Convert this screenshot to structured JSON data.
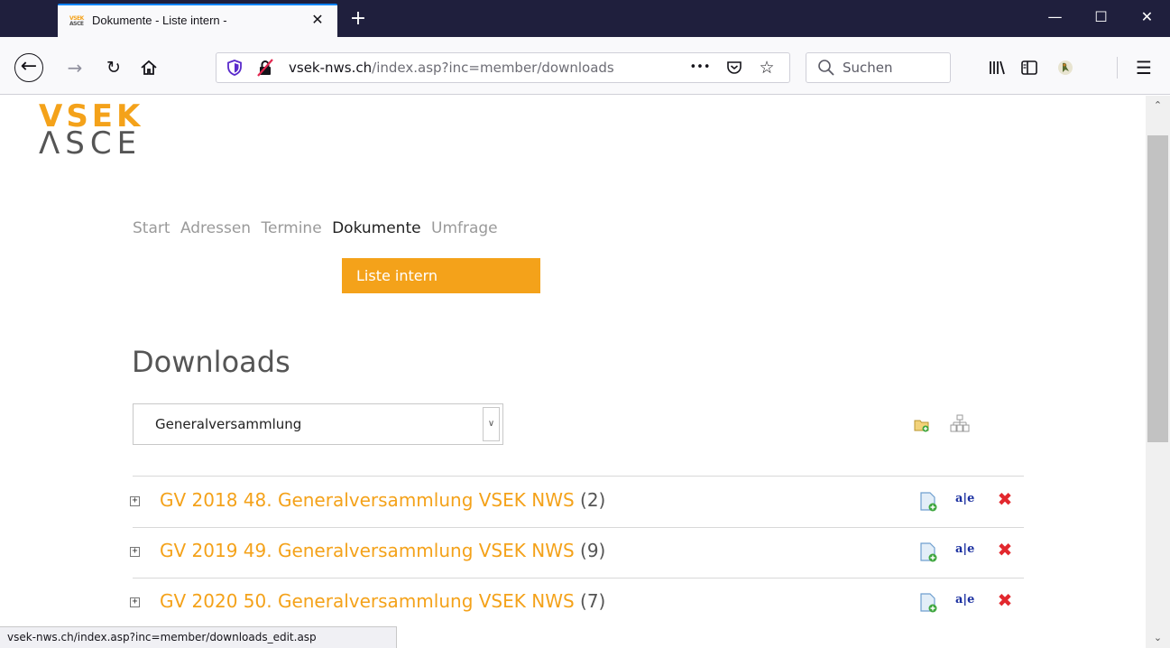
{
  "browser": {
    "tab_title": "Dokumente - Liste intern -",
    "favicon_text_top": "VSEK",
    "favicon_text_bottom": "ASCE",
    "new_tab": "+",
    "tab_close": "✕",
    "url_domain": "vsek-nws.ch",
    "url_path": "/index.asp?inc=member/downloads",
    "search_placeholder": "Suchen",
    "page_actions": "•••",
    "status_url": "vsek-nws.ch/index.asp?inc=member/downloads_edit.asp",
    "accent_color": "#0a84ff"
  },
  "site": {
    "logo_line1": "VSEK",
    "logo_line2": "ΛSCE",
    "brand_color": "#f4a21a"
  },
  "nav": {
    "items": [
      {
        "label": "Start"
      },
      {
        "label": "Adressen"
      },
      {
        "label": "Termine"
      },
      {
        "label": "Dokumente"
      },
      {
        "label": "Umfrage"
      }
    ],
    "active": "Dokumente",
    "subnav_label": "Liste intern"
  },
  "main": {
    "heading": "Downloads",
    "category_select": {
      "value": "Generalversammlung"
    },
    "rows": [
      {
        "title": "GV 2018 48. Generalversammlung VSEK NWS",
        "count": "(2)"
      },
      {
        "title": "GV 2019 49. Generalversammlung VSEK NWS",
        "count": "(9)"
      },
      {
        "title": "GV 2020 50. Generalversammlung VSEK NWS",
        "count": "(7)"
      }
    ]
  }
}
